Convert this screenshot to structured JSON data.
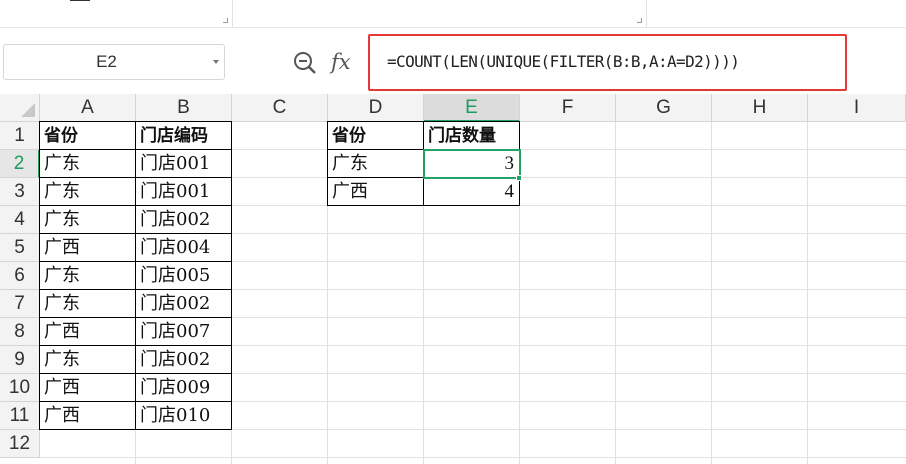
{
  "name_box": {
    "value": "E2"
  },
  "formula_bar": {
    "formula": "=COUNT(LEN(UNIQUE(FILTER(B:B,A:A=D2))))",
    "fx_label": "fx"
  },
  "columns": [
    "A",
    "B",
    "C",
    "D",
    "E",
    "F",
    "G",
    "H",
    "I"
  ],
  "rows": [
    "1",
    "2",
    "3",
    "4",
    "5",
    "6",
    "7",
    "8",
    "9",
    "10",
    "11",
    "12"
  ],
  "active_cell": "E2",
  "sheet": {
    "A1": "省份",
    "B1": "门店编码",
    "A2": "广东",
    "B2": "门店001",
    "A3": "广东",
    "B3": "门店001",
    "A4": "广东",
    "B4": "门店002",
    "A5": "广西",
    "B5": "门店004",
    "A6": "广东",
    "B6": "门店005",
    "A7": "广东",
    "B7": "门店002",
    "A8": "广西",
    "B8": "门店007",
    "A9": "广东",
    "B9": "门店002",
    "A10": "广西",
    "B10": "门店009",
    "A11": "广西",
    "B11": "门店010",
    "D1": "省份",
    "E1": "门店数量",
    "D2": "广东",
    "E2": "3",
    "D3": "广西",
    "E3": "4"
  },
  "colors": {
    "accent_green": "#21a366",
    "highlight_red": "#e53935"
  },
  "icons": {
    "zoom": "zoom-formula-icon",
    "fx": "insert-function-icon",
    "dropdown": "chevron-down-icon"
  }
}
